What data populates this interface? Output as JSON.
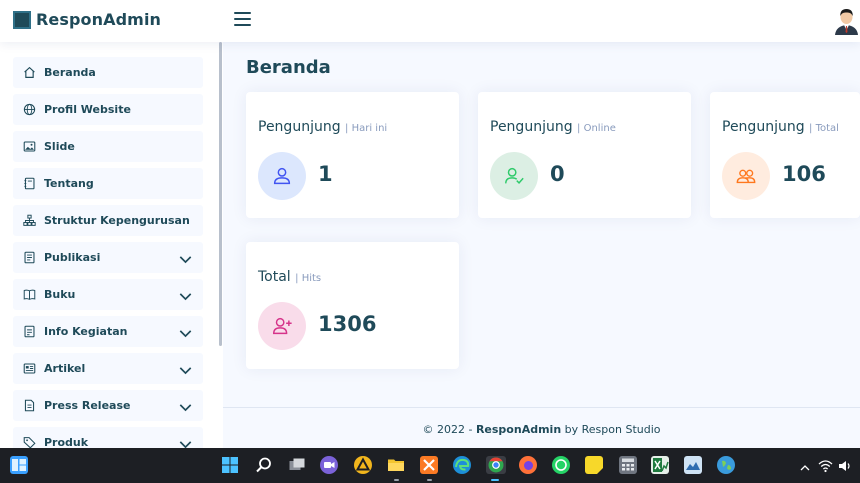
{
  "header": {
    "brand": "ResponAdmin"
  },
  "sidebar": {
    "items": [
      {
        "label": "Beranda",
        "icon": "house-icon"
      },
      {
        "label": "Profil Website",
        "icon": "globe-icon"
      },
      {
        "label": "Slide",
        "icon": "image-icon"
      },
      {
        "label": "Tentang",
        "icon": "journal-icon"
      },
      {
        "label": "Struktur Kepengurusan",
        "icon": "diagram-icon"
      },
      {
        "label": "Publikasi",
        "icon": "file-text-icon"
      },
      {
        "label": "Buku",
        "icon": "book-icon"
      },
      {
        "label": "Info Kegiatan",
        "icon": "file-richtext-icon"
      },
      {
        "label": "Artikel",
        "icon": "newspaper-icon"
      },
      {
        "label": "Press Release",
        "icon": "file-earmark-icon"
      },
      {
        "label": "Produk",
        "icon": "tag-icon"
      }
    ]
  },
  "main": {
    "title": "Beranda",
    "cards": [
      {
        "title": "Pengunjung",
        "sub": "| Hari ini",
        "value": "1",
        "icon": "person-icon",
        "icon_bg": "#dce7fd",
        "icon_color": "#4154f1"
      },
      {
        "title": "Pengunjung",
        "sub": "| Online",
        "value": "0",
        "icon": "person-check-icon",
        "icon_bg": "#dcefe4",
        "icon_color": "#2eca6a"
      },
      {
        "title": "Pengunjung",
        "sub": "| Total",
        "value": "106",
        "icon": "people-icon",
        "icon_bg": "#ffecdf",
        "icon_color": "#ff771d"
      },
      {
        "title": "Total",
        "sub": "| Hits",
        "value": "1306",
        "icon": "person-plus-icon",
        "icon_bg": "#f9dcea",
        "icon_color": "#d6338a"
      }
    ]
  },
  "footer": {
    "prefix": "© 2022 -",
    "brand": "ResponAdmin",
    "suffix": "by Respon Studio"
  },
  "taskbar": {
    "icons": [
      "windows-start-icon",
      "widgets-icon",
      "search-icon",
      "task-view-icon",
      "teams-chat-icon",
      "app-icon",
      "file-explorer-icon",
      "xampp-icon",
      "edge-icon",
      "chrome-icon",
      "firefox-icon",
      "whatsapp-icon",
      "sticky-notes-icon",
      "calculator-icon",
      "excel-chart-icon",
      "photos-icon",
      "globe-app-icon"
    ]
  }
}
